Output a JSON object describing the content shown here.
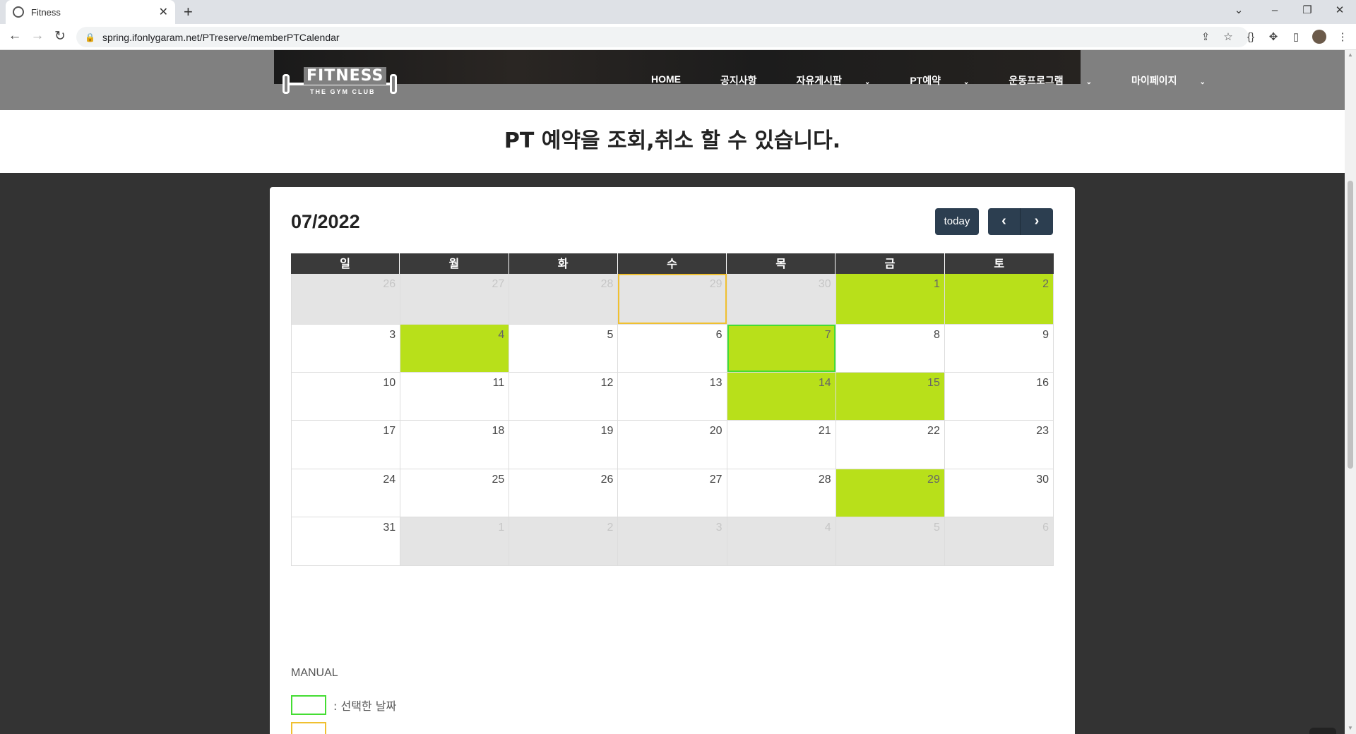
{
  "browser": {
    "tab_title": "Fitness",
    "url": "spring.ifonlygaram.net/PTreserve/memberPTCalendar"
  },
  "site": {
    "logo_text": "FITNESS",
    "logo_sub": "THE GYM CLUB",
    "menu": [
      {
        "label": "HOME",
        "dropdown": false
      },
      {
        "label": "공지사항",
        "dropdown": false
      },
      {
        "label": "자유게시판",
        "dropdown": true
      },
      {
        "label": "PT예약",
        "dropdown": true
      },
      {
        "label": "운동프로그램",
        "dropdown": true
      },
      {
        "label": "마이페이지",
        "dropdown": true
      }
    ],
    "intro_heading": "PT 예약을 조회,취소 할 수 있습니다."
  },
  "calendar": {
    "title": "07/2022",
    "today_label": "today",
    "prev_icon": "chevron-left-icon",
    "next_icon": "chevron-right-icon",
    "weekdays": [
      "일",
      "월",
      "화",
      "수",
      "목",
      "금",
      "토"
    ],
    "colors": {
      "booked": "#b8e01a",
      "today_border": "#f0c030",
      "selected_border": "#44dd33",
      "header_bg": "#3a3a3a",
      "button_bg": "#2c3e50"
    },
    "weeks": [
      [
        {
          "d": "26",
          "o": true
        },
        {
          "d": "27",
          "o": true
        },
        {
          "d": "28",
          "o": true
        },
        {
          "d": "29",
          "o": true,
          "today": true
        },
        {
          "d": "30",
          "o": true
        },
        {
          "d": "1",
          "b": true
        },
        {
          "d": "2",
          "b": true
        }
      ],
      [
        {
          "d": "3"
        },
        {
          "d": "4",
          "b": true
        },
        {
          "d": "5"
        },
        {
          "d": "6"
        },
        {
          "d": "7",
          "b": true,
          "sel": true
        },
        {
          "d": "8"
        },
        {
          "d": "9"
        }
      ],
      [
        {
          "d": "10"
        },
        {
          "d": "11"
        },
        {
          "d": "12"
        },
        {
          "d": "13"
        },
        {
          "d": "14",
          "b": true
        },
        {
          "d": "15",
          "b": true
        },
        {
          "d": "16"
        }
      ],
      [
        {
          "d": "17"
        },
        {
          "d": "18"
        },
        {
          "d": "19"
        },
        {
          "d": "20"
        },
        {
          "d": "21"
        },
        {
          "d": "22"
        },
        {
          "d": "23"
        }
      ],
      [
        {
          "d": "24"
        },
        {
          "d": "25"
        },
        {
          "d": "26"
        },
        {
          "d": "27"
        },
        {
          "d": "28"
        },
        {
          "d": "29",
          "b": true
        },
        {
          "d": "30"
        }
      ],
      [
        {
          "d": "31"
        },
        {
          "d": "1",
          "o": true
        },
        {
          "d": "2",
          "o": true
        },
        {
          "d": "3",
          "o": true
        },
        {
          "d": "4",
          "o": true
        },
        {
          "d": "5",
          "o": true
        },
        {
          "d": "6",
          "o": true
        }
      ]
    ]
  },
  "manual": {
    "heading": "MANUAL",
    "items": [
      {
        "color": "#44dd33",
        "text": ": 선택한 날짜"
      },
      {
        "color": "#f0c030",
        "text": ""
      }
    ]
  }
}
